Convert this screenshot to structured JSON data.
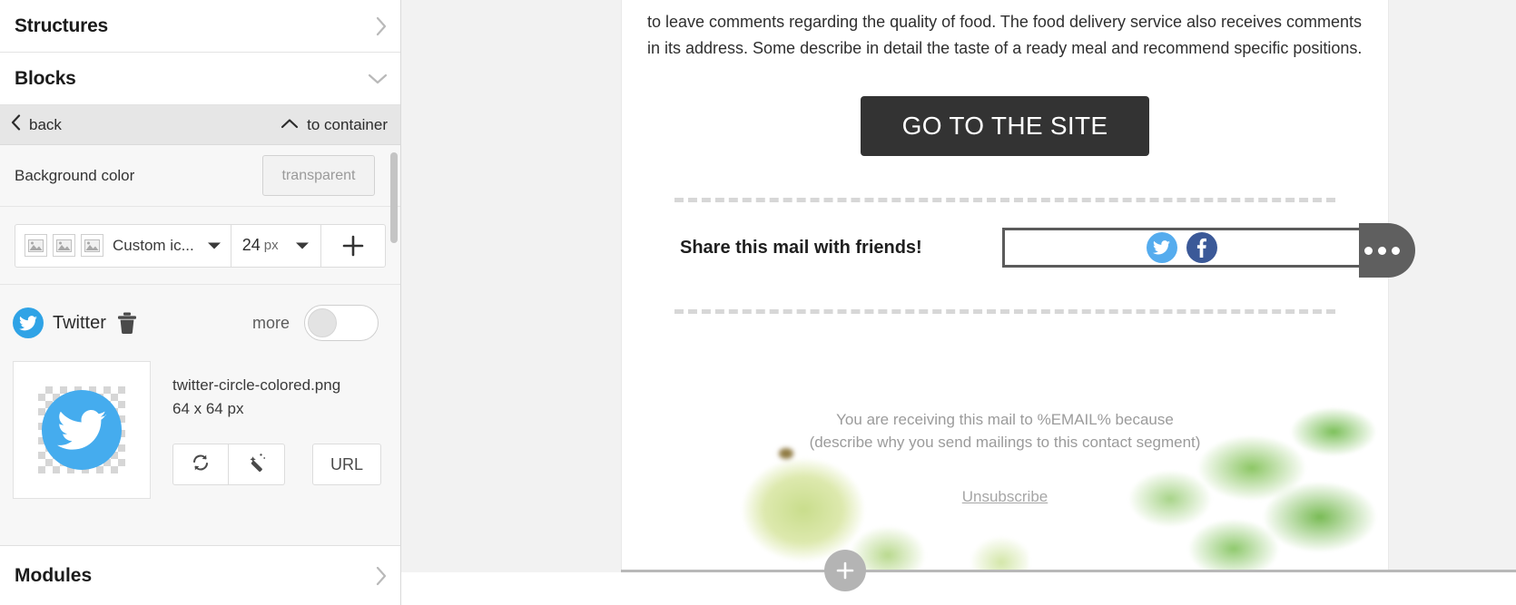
{
  "sidebar": {
    "structures": {
      "title": "Structures",
      "icon": "chevron-right-icon"
    },
    "blocks": {
      "title": "Blocks",
      "icon": "chevron-down-icon"
    },
    "breadcrumb": {
      "back_label": "back",
      "to_container_label": "to container"
    },
    "background_color": {
      "label": "Background color",
      "value": "transparent"
    },
    "icon_picker": {
      "set_label": "Custom ic...",
      "size_value": "24",
      "size_unit": "px",
      "add_label": "+"
    },
    "social_item": {
      "name": "Twitter",
      "more_label": "more",
      "toggle_state": "off"
    },
    "image": {
      "filename": "twitter-circle-colored.png",
      "dimensions": "64 x 64 px",
      "url_button": "URL"
    },
    "modules": {
      "title": "Modules",
      "icon": "chevron-right-icon"
    }
  },
  "email": {
    "paragraph": "to leave comments regarding the quality of food. The food delivery service also receives comments in its address. Some describe in detail the taste of a ready meal and recommend specific positions.",
    "cta_label": "GO TO THE SITE",
    "share_label": "Share this mail with friends!",
    "footer_line1": "You are receiving this mail to %EMAIL% because",
    "footer_line2": "(describe why you send mailings to this contact segment)",
    "unsubscribe_label": "Unsubscribe"
  },
  "colors": {
    "accent_twitter": "#55acee",
    "accent_facebook": "#3b5998",
    "cta_background": "#333333",
    "selection_border": "#5b5b5b",
    "panel_background": "#f7f7f7"
  }
}
